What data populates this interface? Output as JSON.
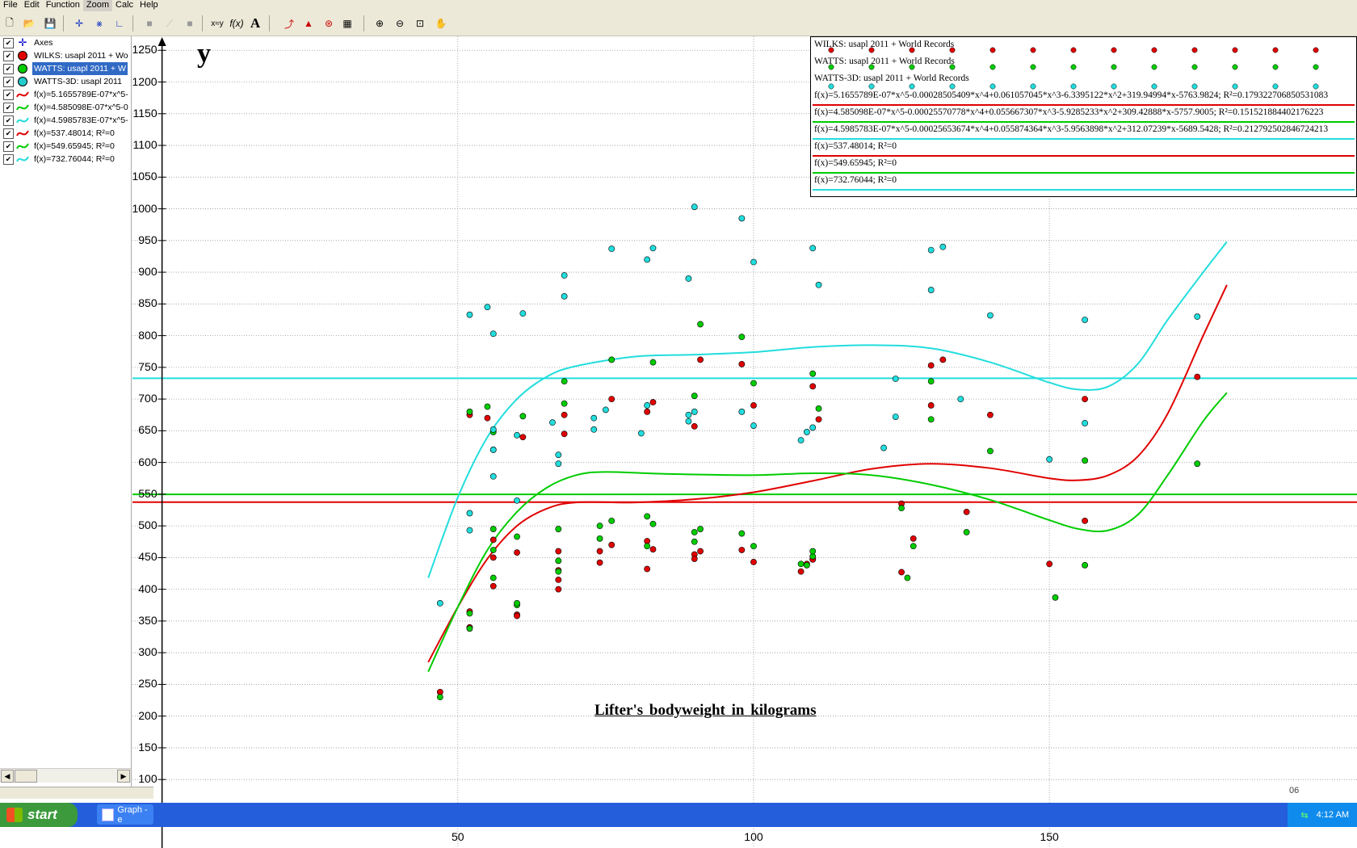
{
  "menu": [
    "File",
    "Edit",
    "Function",
    "Zoom",
    "Calc",
    "Help"
  ],
  "menu_active": "Zoom",
  "toolbar_icons": [
    "new-file",
    "open-file",
    "save-file",
    "axes-tool",
    "insert-function-tool",
    "insert-point-series-tool",
    "insert-shading",
    "insert-trendline",
    "insert-relation",
    "xy-tool",
    "fx-tool",
    "text-tool",
    "tangent-tool",
    "area-tool",
    "evaluate-tool",
    "table-tool",
    "zoom-in",
    "zoom-out",
    "zoom-window",
    "move-hand"
  ],
  "toolbar_text": {
    "xy": "x≈y",
    "fx": "f(x)",
    "text": "A"
  },
  "functions": [
    {
      "label": "Axes",
      "icon": "axes-icon",
      "color": "#0000cc",
      "checked": true,
      "selected": false
    },
    {
      "label": "WILKS: usapl 2011 + World Records",
      "icon": "point-series-icon",
      "color": "#e00000",
      "checked": true,
      "selected": false
    },
    {
      "label": "WATTS: usapl 2011 + World Records",
      "icon": "point-series-icon",
      "color": "#00cc00",
      "checked": true,
      "selected": true
    },
    {
      "label": "WATTS-3D: usapl 2011 + World Records",
      "icon": "point-series-icon",
      "color": "#22cccc",
      "checked": true,
      "selected": false
    },
    {
      "label": "f(x)=5.1655789E-07*x^5-0.00028505409*x^4+0.061057045*x^3-6.3395122*x^2+319.94994*x-5763.9824; R²=0.179322706850531083",
      "icon": "function-icon",
      "color": "#e00000",
      "checked": true,
      "selected": false
    },
    {
      "label": "f(x)=4.585098E-07*x^5-0.00025570778*x^4+0.055667307*x^3-5.9285233*x^2+309.42888*x-5757.9005; R²=0.151521884402176223",
      "icon": "function-icon",
      "color": "#00cc00",
      "checked": true,
      "selected": false
    },
    {
      "label": "f(x)=4.5985783E-07*x^5-0.00025653674*x^4+0.055874364*x^3-5.9563898*x^2+312.07239*x-5689.5428; R²=0.212792502846724213",
      "icon": "function-icon",
      "color": "#22dddd",
      "checked": true,
      "selected": false
    },
    {
      "label": "f(x)=537.48014; R²=0",
      "icon": "function-icon",
      "color": "#e00000",
      "checked": true,
      "selected": false
    },
    {
      "label": "f(x)=549.65945; R²=0",
      "icon": "function-icon",
      "color": "#00cc00",
      "checked": true,
      "selected": false
    },
    {
      "label": "f(x)=732.76044; R²=0",
      "icon": "function-icon",
      "color": "#22dddd",
      "checked": true,
      "selected": false
    }
  ],
  "sidebar_labels": [
    "Axes",
    "WILKS: usapl 2011 + Wo",
    "WATTS: usapl 2011 + W",
    "WATTS-3D: usapl 2011",
    "f(x)=5.1655789E-07*x^5-",
    "f(x)=4.585098E-07*x^5-0",
    "f(x)=4.5985783E-07*x^5-",
    "f(x)=537.48014; R²=0",
    "f(x)=549.65945; R²=0",
    "f(x)=732.76044; R²=0"
  ],
  "legend_rows": [
    "WILKS: usapl 2011 + World Records",
    "WATTS: usapl 2011 + World Records",
    "WATTS-3D: usapl 2011 + World Records",
    "f(x)=5.1655789E-07*x^5-0.00028505409*x^4+0.061057045*x^3-6.3395122*x^2+319.94994*x-5763.9824; R²=0.179322706850531083",
    "f(x)=4.585098E-07*x^5-0.00025570778*x^4+0.055667307*x^3-5.9285233*x^2+309.42888*x-5757.9005; R²=0.151521884402176223",
    "f(x)=4.5985783E-07*x^5-0.00025653674*x^4+0.055874364*x^3-5.9563898*x^2+312.07239*x-5689.5428; R²=0.212792502846724213",
    "f(x)=537.48014; R²=0",
    "f(x)=549.65945; R²=0",
    "f(x)=732.76044; R²=0"
  ],
  "taskbar": {
    "start": "start",
    "task": "Graph - e",
    "clock": "4:12 AM",
    "partial": "06"
  },
  "colors": {
    "wilks": "#e00000",
    "watts": "#00cc00",
    "watts3d": "#22dddd"
  },
  "chart_data": {
    "type": "scatter",
    "xlabel": "Lifter's bodyweight in kilograms",
    "ylabel": "y",
    "xlim": [
      -5,
      202
    ],
    "ylim": [
      -8,
      1272
    ],
    "x_ticks": [
      50,
      100,
      150
    ],
    "y_ticks": [
      50,
      100,
      150,
      200,
      250,
      300,
      350,
      400,
      450,
      500,
      550,
      600,
      650,
      700,
      750,
      800,
      850,
      900,
      950,
      1000,
      1050,
      1100,
      1150,
      1200,
      1250
    ],
    "grid": true,
    "series": [
      {
        "name": "WILKS: usapl 2011 + World Records",
        "color": "#e00000",
        "points": [
          [
            47,
            238
          ],
          [
            52,
            365
          ],
          [
            52,
            340
          ],
          [
            56,
            405
          ],
          [
            56,
            450
          ],
          [
            56,
            478
          ],
          [
            55,
            670
          ],
          [
            56,
            620
          ],
          [
            52,
            675
          ],
          [
            60,
            360
          ],
          [
            60,
            358
          ],
          [
            60,
            458
          ],
          [
            61,
            640
          ],
          [
            67,
            460
          ],
          [
            67,
            430
          ],
          [
            67,
            415
          ],
          [
            67,
            400
          ],
          [
            68,
            675
          ],
          [
            68,
            645
          ],
          [
            74,
            460
          ],
          [
            74,
            442
          ],
          [
            76,
            470
          ],
          [
            76,
            700
          ],
          [
            82,
            476
          ],
          [
            83,
            463
          ],
          [
            82,
            432
          ],
          [
            83,
            695
          ],
          [
            82,
            680
          ],
          [
            90,
            455
          ],
          [
            90,
            448
          ],
          [
            91,
            460
          ],
          [
            91,
            762
          ],
          [
            90,
            657
          ],
          [
            98,
            462
          ],
          [
            98,
            755
          ],
          [
            100,
            443
          ],
          [
            100,
            690
          ],
          [
            108,
            428
          ],
          [
            110,
            447
          ],
          [
            109,
            440
          ],
          [
            110,
            447
          ],
          [
            110,
            720
          ],
          [
            111,
            668
          ],
          [
            125,
            535
          ],
          [
            125,
            427
          ],
          [
            127,
            480
          ],
          [
            130,
            753
          ],
          [
            130,
            690
          ],
          [
            132,
            762
          ],
          [
            136,
            522
          ],
          [
            140,
            675
          ],
          [
            150,
            440
          ],
          [
            156,
            508
          ],
          [
            156,
            700
          ],
          [
            175,
            735
          ]
        ]
      },
      {
        "name": "WATTS: usapl 2011 + World Records",
        "color": "#00cc00",
        "points": [
          [
            47,
            230
          ],
          [
            52,
            362
          ],
          [
            52,
            338
          ],
          [
            56,
            418
          ],
          [
            56,
            462
          ],
          [
            56,
            495
          ],
          [
            55,
            688
          ],
          [
            56,
            648
          ],
          [
            52,
            680
          ],
          [
            60,
            375
          ],
          [
            60,
            378
          ],
          [
            60,
            483
          ],
          [
            61,
            673
          ],
          [
            67,
            495
          ],
          [
            67,
            445
          ],
          [
            67,
            428
          ],
          [
            68,
            693
          ],
          [
            68,
            728
          ],
          [
            74,
            500
          ],
          [
            74,
            480
          ],
          [
            76,
            508
          ],
          [
            76,
            762
          ],
          [
            82,
            515
          ],
          [
            83,
            503
          ],
          [
            82,
            468
          ],
          [
            83,
            758
          ],
          [
            90,
            490
          ],
          [
            90,
            475
          ],
          [
            91,
            495
          ],
          [
            91,
            818
          ],
          [
            90,
            705
          ],
          [
            98,
            488
          ],
          [
            98,
            798
          ],
          [
            100,
            468
          ],
          [
            100,
            725
          ],
          [
            108,
            440
          ],
          [
            110,
            452
          ],
          [
            109,
            438
          ],
          [
            110,
            460
          ],
          [
            110,
            740
          ],
          [
            111,
            685
          ],
          [
            125,
            528
          ],
          [
            126,
            418
          ],
          [
            127,
            468
          ],
          [
            130,
            728
          ],
          [
            130,
            668
          ],
          [
            136,
            490
          ],
          [
            140,
            618
          ],
          [
            151,
            387
          ],
          [
            156,
            438
          ],
          [
            156,
            603
          ],
          [
            175,
            598
          ]
        ]
      },
      {
        "name": "WATTS-3D: usapl 2011 + World Records",
        "color": "#22dddd",
        "points": [
          [
            47,
            378
          ],
          [
            52,
            520
          ],
          [
            52,
            493
          ],
          [
            52,
            833
          ],
          [
            56,
            578
          ],
          [
            56,
            652
          ],
          [
            56,
            620
          ],
          [
            55,
            845
          ],
          [
            56,
            803
          ],
          [
            60,
            540
          ],
          [
            60,
            643
          ],
          [
            61,
            835
          ],
          [
            66,
            663
          ],
          [
            67,
            612
          ],
          [
            67,
            598
          ],
          [
            68,
            862
          ],
          [
            68,
            895
          ],
          [
            73,
            670
          ],
          [
            73,
            652
          ],
          [
            75,
            683
          ],
          [
            76,
            937
          ],
          [
            81,
            646
          ],
          [
            82,
            690
          ],
          [
            82,
            920
          ],
          [
            83,
            938
          ],
          [
            89,
            675
          ],
          [
            89,
            665
          ],
          [
            90,
            680
          ],
          [
            89,
            890
          ],
          [
            90,
            1003
          ],
          [
            98,
            680
          ],
          [
            98,
            985
          ],
          [
            100,
            916
          ],
          [
            100,
            658
          ],
          [
            108,
            635
          ],
          [
            109,
            648
          ],
          [
            110,
            655
          ],
          [
            110,
            938
          ],
          [
            111,
            880
          ],
          [
            124,
            732
          ],
          [
            124,
            672
          ],
          [
            122,
            623
          ],
          [
            130,
            935
          ],
          [
            130,
            872
          ],
          [
            132,
            940
          ],
          [
            135,
            700
          ],
          [
            140,
            832
          ],
          [
            150,
            605
          ],
          [
            156,
            662
          ],
          [
            156,
            825
          ],
          [
            175,
            830
          ]
        ]
      }
    ],
    "curves": [
      {
        "name": "f(x)=5.1655789E-07*x^5-0.00028505409*x^4+0.061057045*x^3-6.3395122*x^2+319.94994*x-5763.9824",
        "color": "#e00000",
        "points": [
          [
            45,
            285
          ],
          [
            50,
            372
          ],
          [
            55,
            448
          ],
          [
            60,
            500
          ],
          [
            65,
            527
          ],
          [
            70,
            537
          ],
          [
            80,
            537
          ],
          [
            90,
            542
          ],
          [
            100,
            553
          ],
          [
            110,
            571
          ],
          [
            120,
            590
          ],
          [
            130,
            598
          ],
          [
            140,
            591
          ],
          [
            150,
            575
          ],
          [
            155,
            572
          ],
          [
            160,
            580
          ],
          [
            165,
            610
          ],
          [
            170,
            677
          ],
          [
            176,
            800
          ],
          [
            180,
            880
          ]
        ]
      },
      {
        "name": "f(x)=4.585098E-07*x^5-0.00025570778*x^4+0.055667307*x^3-5.9285233*x^2+309.42888*x-5757.9005",
        "color": "#00cc00",
        "points": [
          [
            45,
            270
          ],
          [
            50,
            372
          ],
          [
            55,
            462
          ],
          [
            60,
            522
          ],
          [
            65,
            560
          ],
          [
            70,
            580
          ],
          [
            75,
            585
          ],
          [
            85,
            582
          ],
          [
            100,
            580
          ],
          [
            110,
            583
          ],
          [
            120,
            580
          ],
          [
            130,
            565
          ],
          [
            140,
            541
          ],
          [
            150,
            509
          ],
          [
            155,
            495
          ],
          [
            160,
            493
          ],
          [
            165,
            518
          ],
          [
            170,
            580
          ],
          [
            176,
            665
          ],
          [
            180,
            710
          ]
        ]
      },
      {
        "name": "f(x)=4.5985783E-07*x^5-0.00025653674*x^4+0.055874364*x^3-5.9563898*x^2+312.07239*x-5689.5428",
        "color": "#22dddd",
        "points": [
          [
            45,
            418
          ],
          [
            50,
            545
          ],
          [
            55,
            640
          ],
          [
            60,
            700
          ],
          [
            65,
            735
          ],
          [
            70,
            752
          ],
          [
            80,
            767
          ],
          [
            90,
            770
          ],
          [
            100,
            774
          ],
          [
            110,
            782
          ],
          [
            120,
            785
          ],
          [
            130,
            780
          ],
          [
            140,
            758
          ],
          [
            150,
            726
          ],
          [
            155,
            715
          ],
          [
            160,
            720
          ],
          [
            165,
            756
          ],
          [
            170,
            825
          ],
          [
            176,
            900
          ],
          [
            180,
            948
          ]
        ]
      }
    ],
    "hlines": [
      {
        "name": "f(x)=537.48014",
        "y": 537.48014,
        "color": "#e00000"
      },
      {
        "name": "f(x)=549.65945",
        "y": 549.65945,
        "color": "#00cc00"
      },
      {
        "name": "f(x)=732.76044",
        "y": 732.76044,
        "color": "#22dddd"
      }
    ]
  }
}
